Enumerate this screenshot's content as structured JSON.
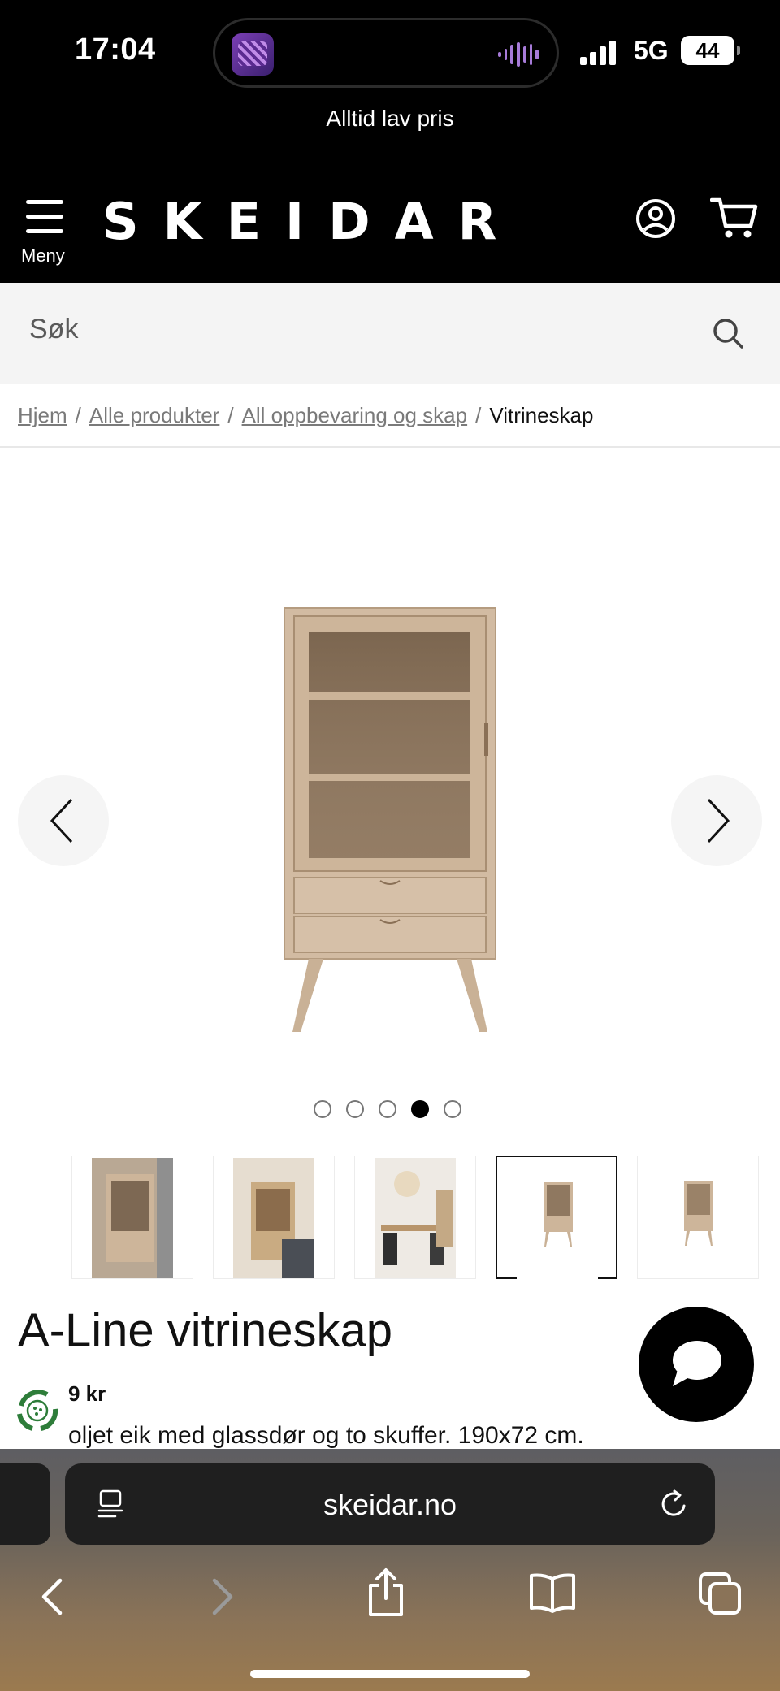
{
  "status_bar": {
    "time": "17:04",
    "network": "5G",
    "battery": "44"
  },
  "header": {
    "promo_text": "Alltid lav pris",
    "menu_label": "Meny",
    "logo_text": "SKEIDAR"
  },
  "search": {
    "placeholder": "Søk"
  },
  "breadcrumb": {
    "items": [
      "Hjem",
      "Alle produkter",
      "All oppbevaring og skap"
    ],
    "current": "Vitrineskap",
    "separator": "/"
  },
  "gallery": {
    "total_images": 5,
    "active_index": 4,
    "selected_thumbnail": 4
  },
  "product": {
    "title": "A-Line vitrineskap",
    "price_partial": "9 kr",
    "description_partial": "oljet eik med glassdør og to skuffer. 190x72 cm."
  },
  "browser": {
    "url": "skeidar.no"
  },
  "colors": {
    "header_bg": "#000000",
    "search_bg": "#f4f4f4",
    "wood": "#cdb59a",
    "wood_dark": "#8a7056"
  }
}
